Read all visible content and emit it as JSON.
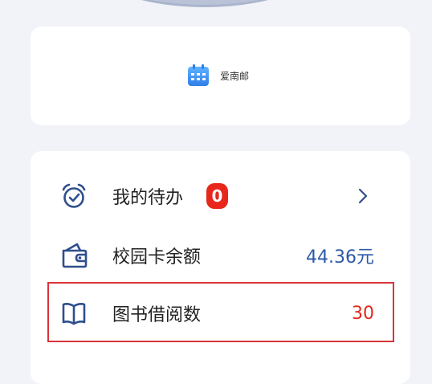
{
  "apps": [
    {
      "label": "爱南邮",
      "icon": "calendar-icon",
      "icon_color": "#3b8df0"
    }
  ],
  "list": {
    "todo": {
      "label": "我的待办",
      "badge": "0",
      "icon": "alarm-clock-icon"
    },
    "card_balance": {
      "label": "校园卡余额",
      "value": "44.36元",
      "icon": "wallet-icon"
    },
    "library": {
      "label": "图书借阅数",
      "value": "30",
      "icon": "open-book-icon"
    }
  },
  "colors": {
    "accent_blue": "#2f4e8c",
    "balance_blue": "#2c5aa8",
    "alert_red": "#e8261c",
    "highlight_red": "#d9343a",
    "background": "#f1f3f8"
  }
}
